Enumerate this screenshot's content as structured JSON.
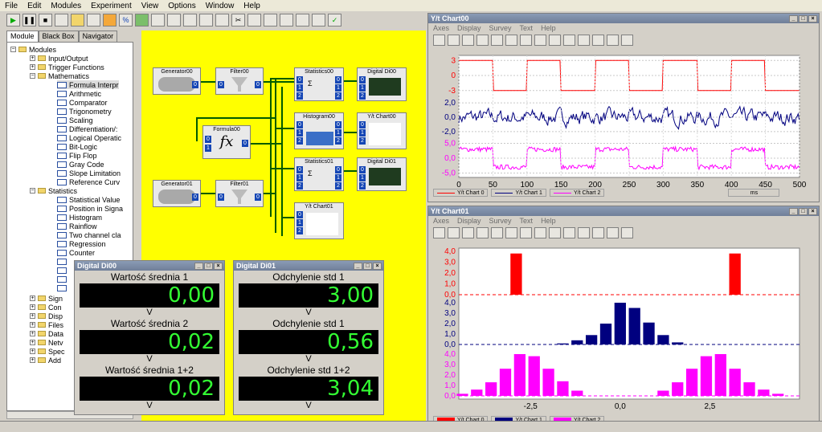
{
  "menu": [
    "File",
    "Edit",
    "Modules",
    "Experiment",
    "View",
    "Options",
    "Window",
    "Help"
  ],
  "tabs": [
    "Module",
    "Black Box",
    "Navigator"
  ],
  "tree": {
    "root": "Modules",
    "groups": [
      "Input/Output",
      "Trigger Functions",
      "Mathematics"
    ],
    "math_items": [
      "Formula Interpr",
      "Arithmetic",
      "Comparator",
      "Trigonometry",
      "Scaling",
      "Differentiation/:",
      "Logical Operatic",
      "Bit-Logic",
      "Flip Flop",
      "Gray Code",
      "Slope Limitation",
      "Reference Curv"
    ],
    "statistics": "Statistics",
    "stat_items": [
      "Statistical Value",
      "Position in Signa",
      "Histogram",
      "Rainflow",
      "Two channel cla",
      "Regression",
      "Counter"
    ],
    "bottom": [
      "Sign",
      "Con",
      "Disp",
      "Files",
      "Data",
      "Netv",
      "Spec",
      "Add"
    ]
  },
  "blocks": {
    "generator0": "Generator00",
    "filter0": "Filter00",
    "formula": "Formula00",
    "generator1": "Generator01",
    "filter1": "Filter01",
    "stats0": "Statistics00",
    "hist": "Histogram00",
    "stats1": "Statistics01",
    "yt0": "Y/t Chart00",
    "digital0": "Digital Di00",
    "yt1": "Y/t Chart01",
    "digital1": "Digital Di01",
    "fx": "fx",
    "ports": [
      "0",
      "1",
      "2"
    ]
  },
  "digital0": {
    "title": "Digital Di00",
    "rows": [
      {
        "label": "Wartość średnia 1",
        "value": "0,00",
        "unit": "V"
      },
      {
        "label": "Wartość średnia 2",
        "value": "0,02",
        "unit": "V"
      },
      {
        "label": "Wartość średnia 1+2",
        "value": "0,02",
        "unit": "V"
      }
    ]
  },
  "digital1": {
    "title": "Digital Di01",
    "rows": [
      {
        "label": "Odchylenie std 1",
        "value": "3,00",
        "unit": "V"
      },
      {
        "label": "Odchylenie std 1",
        "value": "0,56",
        "unit": "V"
      },
      {
        "label": "Odchylenie std 1+2",
        "value": "3,04",
        "unit": "V"
      }
    ]
  },
  "chart0": {
    "title": "Y/t Chart00",
    "menu": [
      "Axes",
      "Display",
      "Survey",
      "Text",
      "Help"
    ],
    "yticks1": [
      "3",
      "0",
      "-3"
    ],
    "yticks2": [
      "2,0",
      "0,0",
      "-2,0"
    ],
    "yticks3": [
      "5,0",
      "0,0",
      "-5,0"
    ],
    "xticks": [
      "0",
      "50",
      "100",
      "150",
      "200",
      "250",
      "300",
      "350",
      "400",
      "450",
      "500"
    ],
    "unit": "ms",
    "legend": [
      "Y/t Chart 0",
      "Y/t Chart 1",
      "Y/t Chart 2"
    ],
    "colors": [
      "#ff0000",
      "#00007f",
      "#ff00ff"
    ]
  },
  "chart1": {
    "title": "Y/t Chart01",
    "menu": [
      "Axes",
      "Display",
      "Survey",
      "Text",
      "Help"
    ],
    "yticks": [
      "4,0",
      "3,0",
      "2,0",
      "1,0",
      "0,0"
    ],
    "xticks": [
      "-2,5",
      "0,0",
      "2,5"
    ],
    "legend": [
      "Y/t Chart 0",
      "Y/t Chart 1",
      "Y/t Chart 2"
    ],
    "colors": [
      "#ff0000",
      "#00007f",
      "#ff00ff"
    ]
  },
  "chart_data": [
    {
      "type": "line",
      "xlim": [
        0,
        500
      ],
      "series": [
        {
          "name": "Y/t Chart 0",
          "ylim": [
            -4,
            4
          ],
          "square_wave": {
            "high": 3,
            "low": -3,
            "period": 100,
            "start_high": true
          }
        },
        {
          "name": "Y/t Chart 1",
          "ylim": [
            -2.8,
            2.8
          ],
          "noise_amplitude": 0.8
        },
        {
          "name": "Y/t Chart 2",
          "ylim": [
            -6.5,
            6.5
          ],
          "square_wave": {
            "high": 3,
            "low": -3,
            "period": 100,
            "noise": 0.8
          }
        }
      ]
    },
    {
      "type": "bar",
      "xlim": [
        -4.5,
        5
      ],
      "series": [
        {
          "name": "Y/t Chart 0",
          "x": [
            -2.9,
            3.2
          ],
          "values": [
            3.8,
            3.8
          ]
        },
        {
          "name": "Y/t Chart 1",
          "x": [
            -1.6,
            -1.2,
            -0.8,
            -0.4,
            0.0,
            0.4,
            0.8,
            1.2,
            1.6
          ],
          "values": [
            0.1,
            0.4,
            0.9,
            2.0,
            4.0,
            3.5,
            2.1,
            0.9,
            0.2
          ]
        },
        {
          "name": "Y/t Chart 2",
          "x": [
            -4.4,
            -4.0,
            -3.6,
            -3.2,
            -2.8,
            -2.4,
            -2.0,
            -1.6,
            -1.2,
            1.2,
            1.6,
            2.0,
            2.4,
            2.8,
            3.2,
            3.6,
            4.0,
            4.4
          ],
          "values": [
            0.2,
            0.6,
            1.3,
            2.6,
            4.0,
            3.8,
            2.6,
            1.4,
            0.5,
            0.5,
            1.3,
            2.6,
            3.8,
            4.0,
            2.6,
            1.3,
            0.6,
            0.2
          ]
        }
      ]
    }
  ]
}
